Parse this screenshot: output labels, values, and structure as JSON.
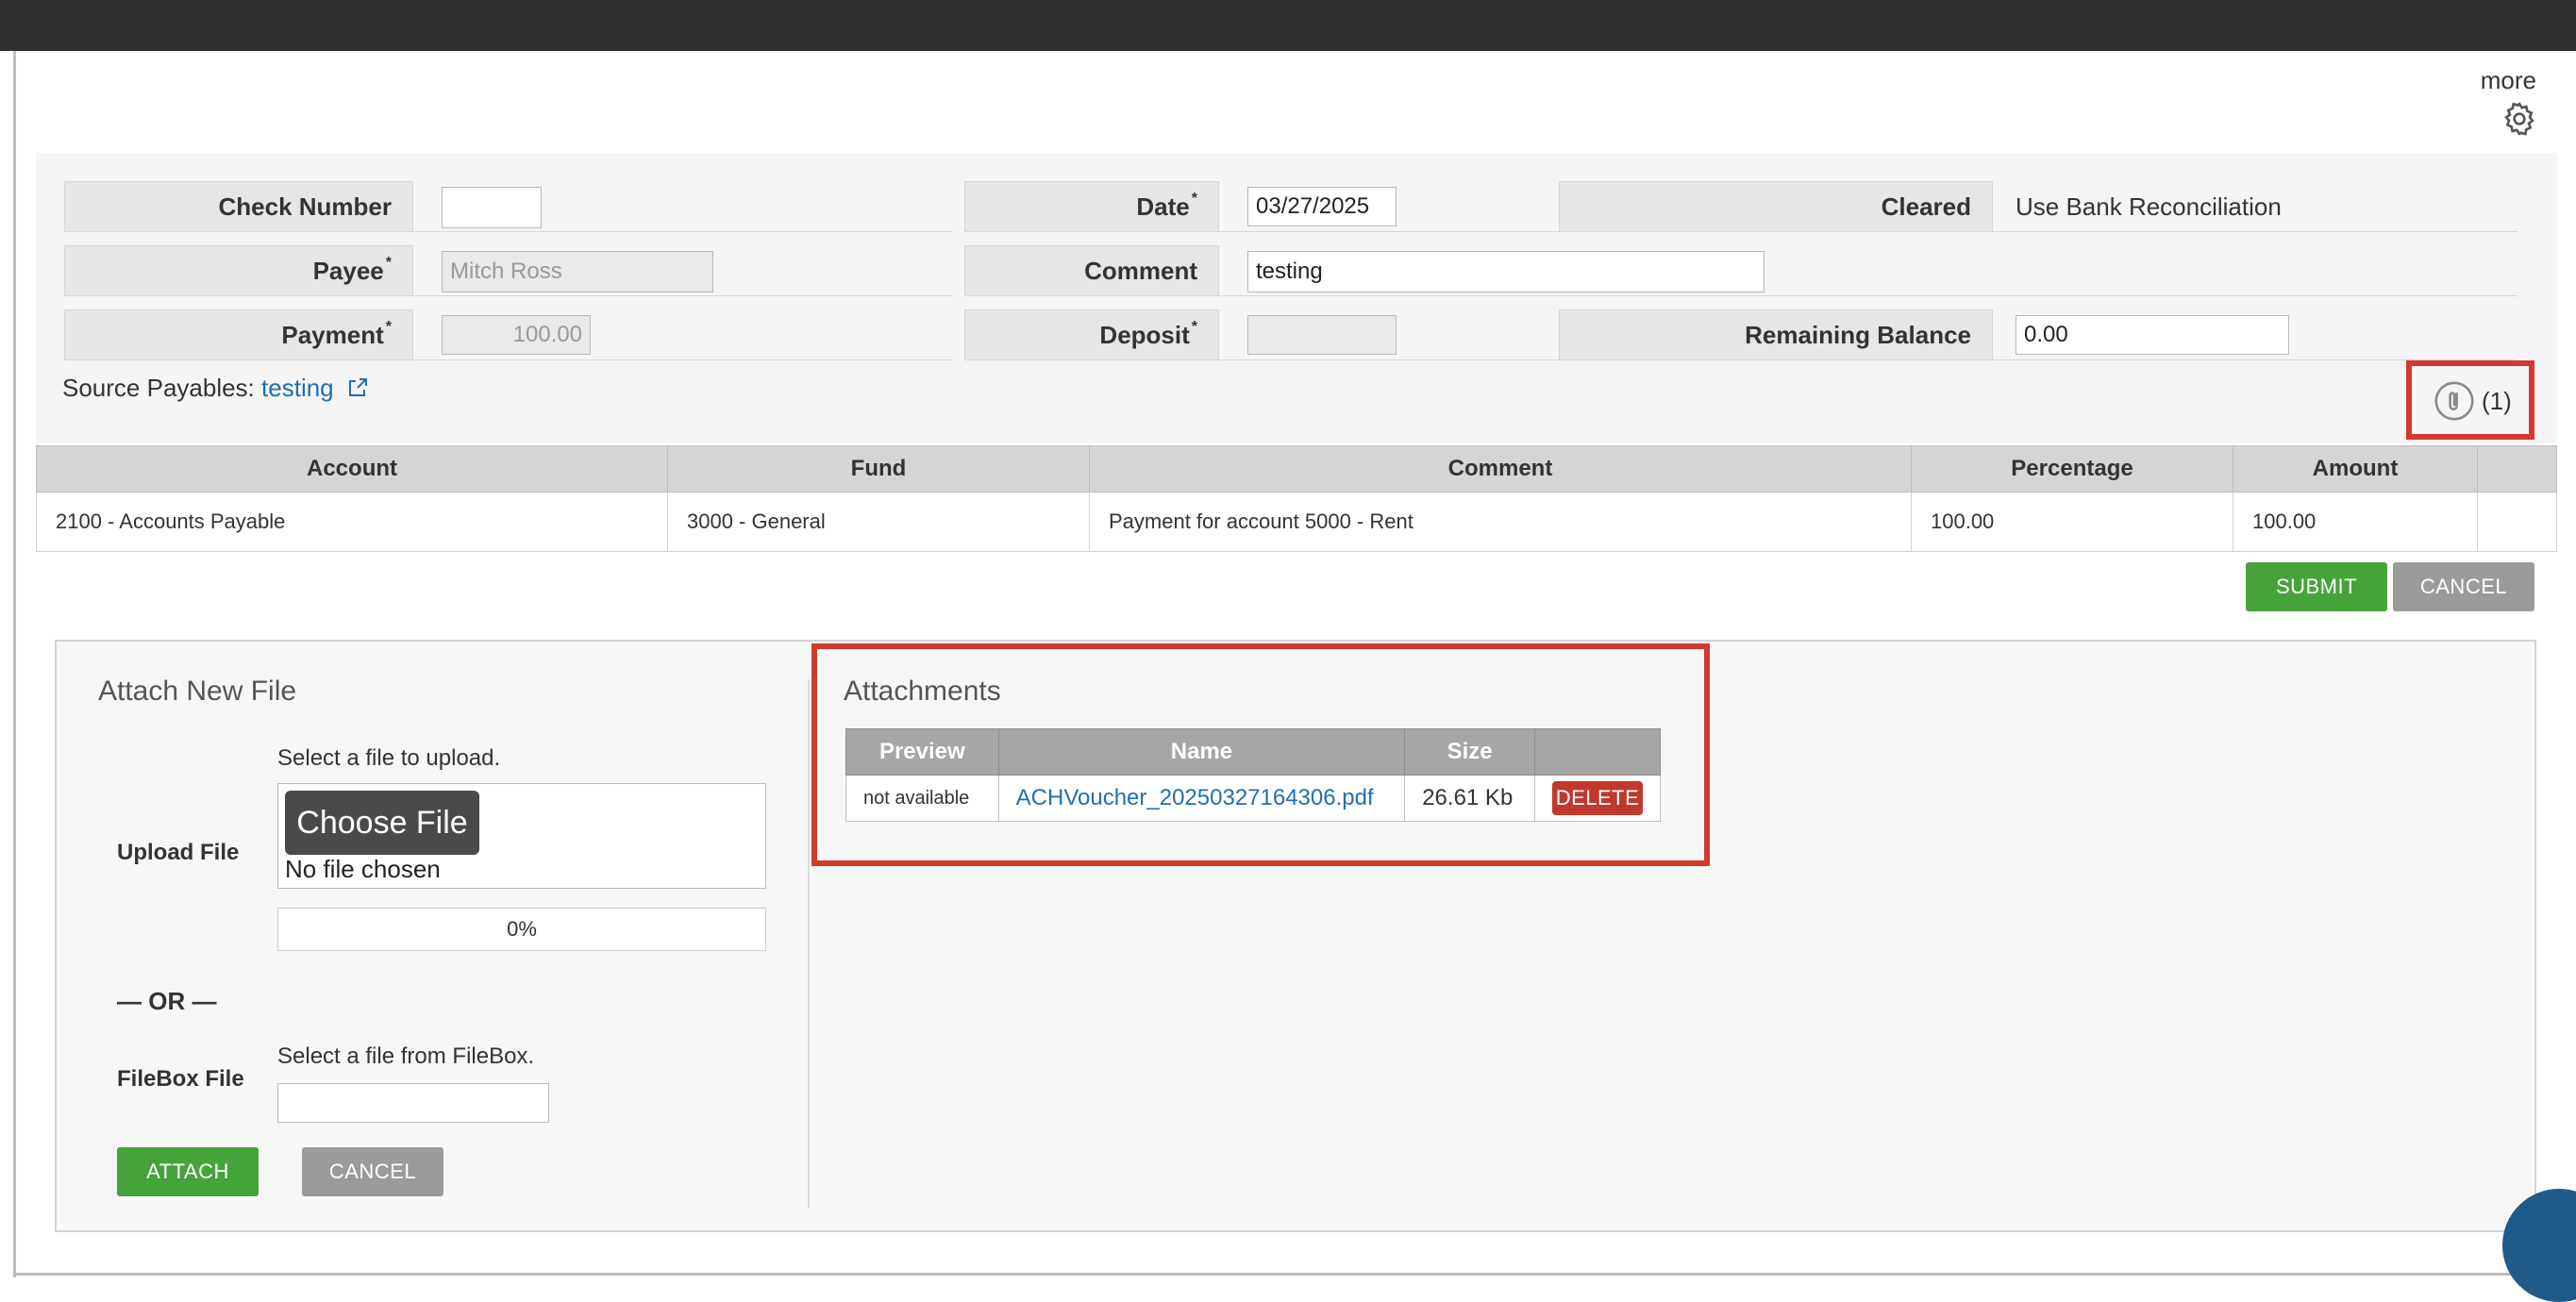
{
  "header": {
    "more_label": "more"
  },
  "form": {
    "check_number_label": "Check Number",
    "check_number_value": "",
    "date_label": "Date",
    "date_value": "03/27/2025",
    "cleared_label": "Cleared",
    "cleared_value": "Use Bank Reconciliation",
    "payee_label": "Payee",
    "payee_value": "Mitch Ross",
    "comment_label": "Comment",
    "comment_value": "testing",
    "payment_label": "Payment",
    "payment_value": "100.00",
    "deposit_label": "Deposit",
    "deposit_value": "",
    "remaining_balance_label": "Remaining Balance",
    "remaining_balance_value": "0.00",
    "required_mark": "*",
    "source_payables_label": "Source Payables:",
    "source_payables_link": "testing",
    "attachment_count": "(1)"
  },
  "grid": {
    "headers": [
      "Account",
      "Fund",
      "Comment",
      "Percentage",
      "Amount",
      ""
    ],
    "rows": [
      [
        "2100 - Accounts Payable",
        "3000 - General",
        "Payment for account 5000 - Rent",
        "100.00",
        "100.00",
        ""
      ]
    ]
  },
  "actions": {
    "submit_label": "SUBMIT",
    "cancel_label": "CANCEL"
  },
  "attach": {
    "title": "Attach New File",
    "upload_label": "Upload File",
    "upload_hint": "Select a file to upload.",
    "choose_file_label": "Choose File",
    "no_file_text": "No file chosen",
    "progress_text": "0%",
    "or_text": "— OR —",
    "filebox_label": "FileBox File",
    "filebox_hint": "Select a file from FileBox.",
    "attach_label": "ATTACH",
    "cancel_label": "CANCEL"
  },
  "attachments": {
    "title": "Attachments",
    "headers": [
      "Preview",
      "Name",
      "Size",
      ""
    ],
    "rows": [
      {
        "preview": "not available",
        "name": "ACHVoucher_20250327164306.pdf",
        "size": "26.61 Kb",
        "action": "DELETE"
      }
    ]
  },
  "colors": {
    "accent_green": "#46a33b",
    "highlight_red": "#d23a2f",
    "link_blue": "#1f6fb2",
    "delete_red": "#c0392b"
  }
}
